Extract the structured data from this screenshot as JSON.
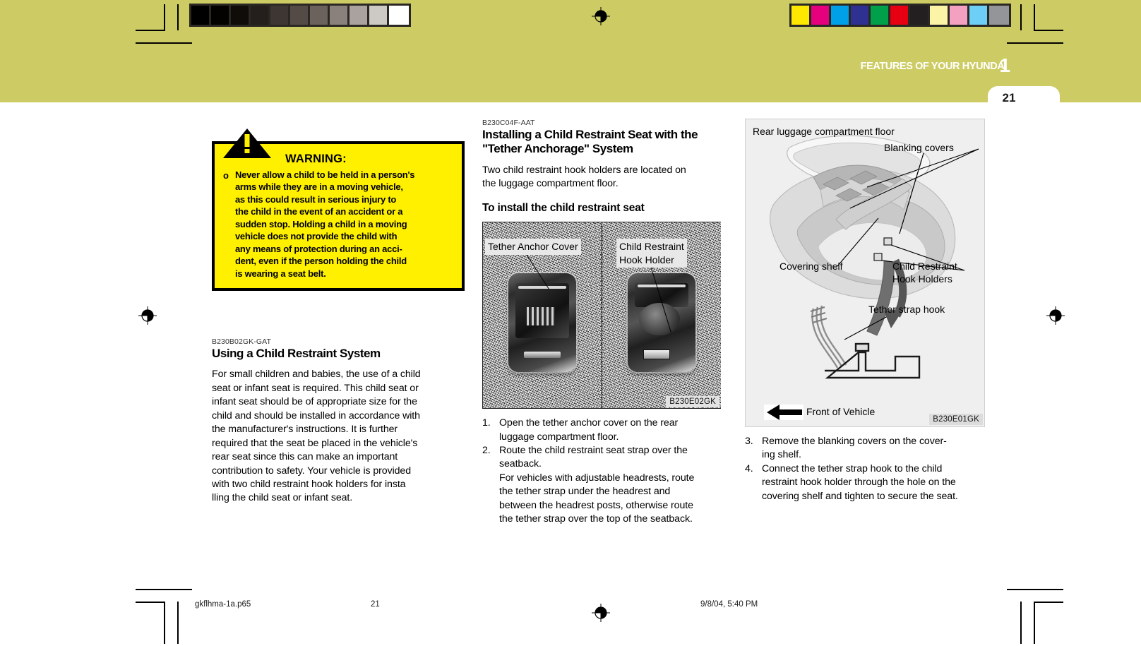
{
  "header": {
    "title": "FEATURES OF YOUR HYUNDAI",
    "chapter": "1",
    "page_tab": "21",
    "band_color": "#cdcc64"
  },
  "calibration": {
    "gray_bar": [
      "#000000",
      "#030201",
      "#100c0a",
      "#241f1d",
      "#3e3633",
      "#544b47",
      "#6b615d",
      "#8a817d",
      "#a9a29e",
      "#cdc9c5",
      "#ffffff"
    ],
    "color_bar": [
      "#ffe800",
      "#e5007e",
      "#00a0e9",
      "#2e3192",
      "#00a04a",
      "#e60012",
      "#231f20",
      "#fbf3a5",
      "#f4a0c0",
      "#6dcff6",
      "#939598"
    ]
  },
  "warning": {
    "icon": "warning-triangle-icon",
    "title": "WARNING:",
    "bullet": "o",
    "lines": [
      "Never allow a child to be held in a person's",
      "arms while they are in a moving vehicle,",
      "as this could result in serious injury to",
      "the child in the event of an accident or a",
      "sudden stop. Holding a child in a moving",
      "vehicle does not provide the child with",
      "any means of protection during an acci-",
      "dent, even if the person holding the child",
      "is wearing a seat belt."
    ],
    "bg_color": "#fff000",
    "border_color": "#000000"
  },
  "left_column": {
    "code": "B230B02GK-GAT",
    "heading": "Using a Child Restraint System",
    "paragraph_lines": [
      "For small children and babies, the use of a child",
      "seat or infant seat is required. This child seat or",
      "infant seat should be of appropriate size for the",
      "child and should be installed in accordance with",
      "the manufacturer's instructions. It is further",
      "required that the seat be placed in the vehicle's",
      "rear seat since this can make an important",
      "contribution to safety. Your vehicle is provided",
      "with two child restraint hook holders for insta",
      "lling the child seat or infant seat."
    ]
  },
  "middle_column": {
    "code": "B230C04F-AAT",
    "heading_line1": "Installing a Child Restraint Seat with the",
    "heading_line2": "\"Tether Anchorage\" System",
    "intro_lines": [
      "Two child restraint hook holders are located on",
      "the luggage compartment floor."
    ],
    "subheading": "To install the child restraint seat",
    "figure": {
      "code": "B230E02GK",
      "label_left": "Tether Anchor Cover",
      "label_right_line1": "Child Restraint",
      "label_right_line2": "Hook Holder"
    },
    "steps": [
      {
        "num": "1.",
        "lines": [
          "Open the tether anchor cover on the rear",
          "luggage compartment floor."
        ]
      },
      {
        "num": "2.",
        "lines": [
          "Route the child restraint seat strap over the",
          "seatback.",
          "For vehicles with adjustable headrests, route",
          "the tether strap under the headrest and",
          "between the headrest posts, otherwise route",
          "the tether strap over the top of the seatback."
        ]
      }
    ]
  },
  "right_column": {
    "figure": {
      "code": "B230E01GK",
      "labels": {
        "floor": "Rear luggage compartment floor",
        "blanking": "Blanking  covers",
        "covering_shelf": "Covering  shelf",
        "hook_holders_line1": "Child  Restraint",
        "hook_holders_line2": "Hook  Holders",
        "tether_strap_hook": "Tether  strap  hook",
        "front_of_vehicle": "Front of Vehicle"
      },
      "front_arrow_icon": "left-arrow-icon"
    },
    "steps": [
      {
        "num": "3.",
        "lines": [
          "Remove the blanking covers on the cover-",
          "ing shelf."
        ]
      },
      {
        "num": "4.",
        "lines": [
          "Connect the tether strap hook to the child",
          "restraint hook holder through the hole on the",
          "covering shelf and tighten to secure the seat."
        ]
      }
    ]
  },
  "footer": {
    "filename": "gkflhma-1a.p65",
    "page": "21",
    "timestamp": "9/8/04, 5:40 PM",
    "registration_icon": "registration-mark-icon"
  }
}
